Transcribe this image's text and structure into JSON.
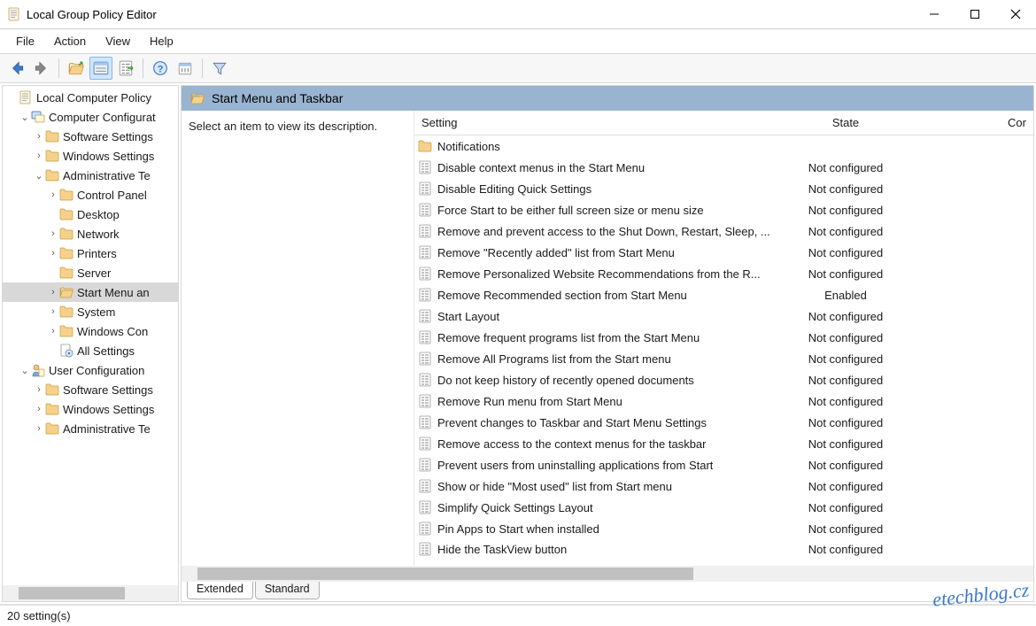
{
  "window": {
    "title": "Local Group Policy Editor"
  },
  "menu": [
    "File",
    "Action",
    "View",
    "Help"
  ],
  "content_header": {
    "title": "Start Menu and Taskbar"
  },
  "description_pane": "Select an item to view its description.",
  "columns": {
    "setting": "Setting",
    "state": "State",
    "comment": "Cor"
  },
  "tree": [
    {
      "level": 0,
      "twisty": "",
      "icon": "gpedit",
      "label": "Local Computer Policy",
      "selected": false
    },
    {
      "level": 1,
      "twisty": "v",
      "icon": "comp",
      "label": "Computer Configurat",
      "selected": false
    },
    {
      "level": 2,
      "twisty": ">",
      "icon": "folder",
      "label": "Software Settings",
      "selected": false
    },
    {
      "level": 2,
      "twisty": ">",
      "icon": "folder",
      "label": "Windows Settings",
      "selected": false
    },
    {
      "level": 2,
      "twisty": "v",
      "icon": "folder",
      "label": "Administrative Te",
      "selected": false
    },
    {
      "level": 3,
      "twisty": ">",
      "icon": "folder",
      "label": "Control Panel",
      "selected": false
    },
    {
      "level": 3,
      "twisty": "",
      "icon": "folder",
      "label": "Desktop",
      "selected": false
    },
    {
      "level": 3,
      "twisty": ">",
      "icon": "folder",
      "label": "Network",
      "selected": false
    },
    {
      "level": 3,
      "twisty": ">",
      "icon": "folder",
      "label": "Printers",
      "selected": false
    },
    {
      "level": 3,
      "twisty": "",
      "icon": "folder",
      "label": "Server",
      "selected": false
    },
    {
      "level": 3,
      "twisty": ">",
      "icon": "folder-open",
      "label": "Start Menu an",
      "selected": true
    },
    {
      "level": 3,
      "twisty": ">",
      "icon": "folder",
      "label": "System",
      "selected": false
    },
    {
      "level": 3,
      "twisty": ">",
      "icon": "folder",
      "label": "Windows Con",
      "selected": false
    },
    {
      "level": 3,
      "twisty": "",
      "icon": "settings-file",
      "label": "All Settings",
      "selected": false
    },
    {
      "level": 1,
      "twisty": "v",
      "icon": "user",
      "label": "User Configuration",
      "selected": false
    },
    {
      "level": 2,
      "twisty": ">",
      "icon": "folder",
      "label": "Software Settings",
      "selected": false
    },
    {
      "level": 2,
      "twisty": ">",
      "icon": "folder",
      "label": "Windows Settings",
      "selected": false
    },
    {
      "level": 2,
      "twisty": ">",
      "icon": "folder",
      "label": "Administrative Te",
      "selected": false
    }
  ],
  "settings": [
    {
      "icon": "folder",
      "name": "Notifications",
      "state": ""
    },
    {
      "icon": "setting",
      "name": "Disable context menus in the Start Menu",
      "state": "Not configured"
    },
    {
      "icon": "setting",
      "name": "Disable Editing Quick Settings",
      "state": "Not configured"
    },
    {
      "icon": "setting",
      "name": "Force Start to be either full screen size or menu size",
      "state": "Not configured"
    },
    {
      "icon": "setting",
      "name": "Remove and prevent access to the Shut Down, Restart, Sleep, ...",
      "state": "Not configured"
    },
    {
      "icon": "setting",
      "name": "Remove \"Recently added\" list from Start Menu",
      "state": "Not configured"
    },
    {
      "icon": "setting",
      "name": "Remove Personalized Website Recommendations from the R...",
      "state": "Not configured"
    },
    {
      "icon": "setting",
      "name": "Remove Recommended section from Start Menu",
      "state": "Enabled"
    },
    {
      "icon": "setting",
      "name": "Start Layout",
      "state": "Not configured"
    },
    {
      "icon": "setting",
      "name": "Remove frequent programs list from the Start Menu",
      "state": "Not configured"
    },
    {
      "icon": "setting",
      "name": "Remove All Programs list from the Start menu",
      "state": "Not configured"
    },
    {
      "icon": "setting",
      "name": "Do not keep history of recently opened documents",
      "state": "Not configured"
    },
    {
      "icon": "setting",
      "name": "Remove Run menu from Start Menu",
      "state": "Not configured"
    },
    {
      "icon": "setting",
      "name": "Prevent changes to Taskbar and Start Menu Settings",
      "state": "Not configured"
    },
    {
      "icon": "setting",
      "name": "Remove access to the context menus for the taskbar",
      "state": "Not configured"
    },
    {
      "icon": "setting",
      "name": "Prevent users from uninstalling applications from Start",
      "state": "Not configured"
    },
    {
      "icon": "setting",
      "name": "Show or hide \"Most used\" list from Start menu",
      "state": "Not configured"
    },
    {
      "icon": "setting",
      "name": "Simplify Quick Settings Layout",
      "state": "Not configured"
    },
    {
      "icon": "setting",
      "name": "Pin Apps to Start when installed",
      "state": "Not configured"
    },
    {
      "icon": "setting",
      "name": "Hide the TaskView button",
      "state": "Not configured"
    }
  ],
  "tabs": {
    "extended": "Extended",
    "standard": "Standard"
  },
  "status": "20 setting(s)",
  "watermark": "etechblog.cz"
}
